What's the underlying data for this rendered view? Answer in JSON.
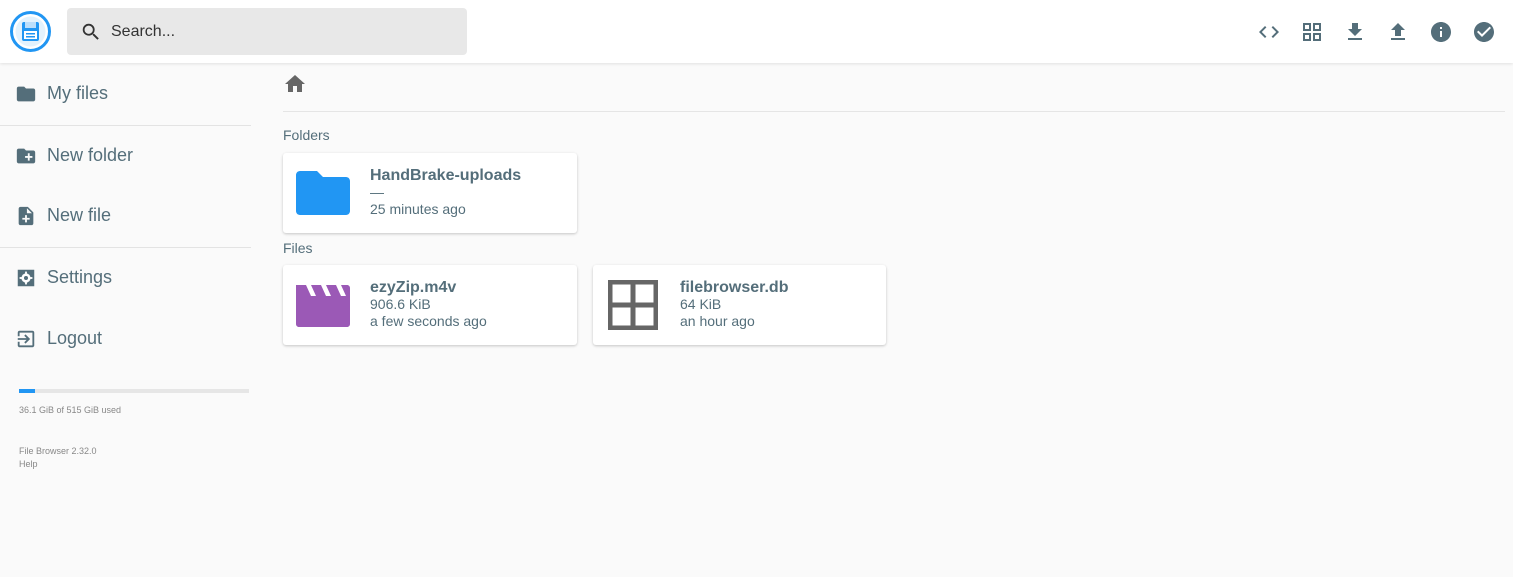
{
  "header": {
    "logo_icon": "floppy-disk-logo",
    "search": {
      "placeholder": "Search..."
    },
    "actions": [
      {
        "name": "code-icon",
        "label": "Toggle code view"
      },
      {
        "name": "grid-view-icon",
        "label": "Switch view"
      },
      {
        "name": "download-icon",
        "label": "Download"
      },
      {
        "name": "upload-icon",
        "label": "Upload"
      },
      {
        "name": "info-icon",
        "label": "Info"
      },
      {
        "name": "check-circle-icon",
        "label": "Select multiple"
      }
    ]
  },
  "sidebar": {
    "items": [
      {
        "label": "My files",
        "icon": "folder-icon"
      },
      {
        "label": "New folder",
        "icon": "create-new-folder-icon"
      },
      {
        "label": "New file",
        "icon": "note-add-icon"
      },
      {
        "label": "Settings",
        "icon": "settings-icon"
      },
      {
        "label": "Logout",
        "icon": "exit-icon"
      }
    ],
    "quota": {
      "text": "36.1 GiB of 515 GiB used",
      "used_fraction": 0.07
    },
    "credits": {
      "version": "File Browser 2.32.0",
      "help": "Help"
    }
  },
  "main": {
    "breadcrumb_icon": "home-icon",
    "folders_title": "Folders",
    "files_title": "Files",
    "folders": [
      {
        "name": "HandBrake-uploads",
        "size": "—",
        "modified": "25 minutes ago",
        "icon": "folder-icon"
      }
    ],
    "files": [
      {
        "name": "ezyZip.m4v",
        "size": "906.6 KiB",
        "modified": "a few seconds ago",
        "icon": "movie-icon"
      },
      {
        "name": "filebrowser.db",
        "size": "64 KiB",
        "modified": "an hour ago",
        "icon": "database-grid-icon"
      }
    ]
  },
  "colors": {
    "accent": "#2196f3",
    "folder": "#2196f3",
    "video": "#9b59b6",
    "generic_file": "#666666",
    "text": "#546e7a"
  }
}
